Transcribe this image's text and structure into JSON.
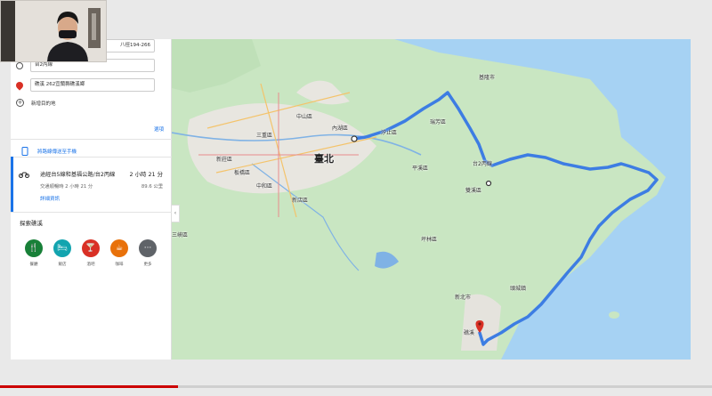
{
  "sidebar": {
    "stops": [
      {
        "label": "八徑194-266"
      },
      {
        "label": "台2丙線"
      },
      {
        "label": "礁溪 262宜蘭縣礁溪鄉"
      }
    ],
    "add_destination": "新增目的地",
    "options_link": "選項",
    "send_to_phone": "將路線傳送至手機",
    "route": {
      "title": "途經台5線和基福公路/台2丙線",
      "time": "2 小時 21 分",
      "traffic": "交通順暢時 2 小時 21 分",
      "distance": "89.6 公里",
      "details_link": "詳細資訊"
    },
    "explore_title": "探索礁溪",
    "categories": [
      {
        "label": "餐廳",
        "icon": "restaurant-icon",
        "color": "#188038",
        "glyph": "🍴"
      },
      {
        "label": "飯店",
        "icon": "hotel-icon",
        "color": "#12a4af",
        "glyph": "🛏"
      },
      {
        "label": "酒吧",
        "icon": "bar-icon",
        "color": "#d93025",
        "glyph": "🍸"
      },
      {
        "label": "咖啡",
        "icon": "coffee-icon",
        "color": "#e8710a",
        "glyph": "☕"
      },
      {
        "label": "更多",
        "icon": "more-icon",
        "color": "#5f6368",
        "glyph": "···"
      }
    ]
  },
  "map": {
    "city_label": "臺北",
    "labels": [
      {
        "text": "中山區"
      },
      {
        "text": "內湖區"
      },
      {
        "text": "汐止區"
      },
      {
        "text": "新店區"
      },
      {
        "text": "中和區"
      },
      {
        "text": "板橋區"
      },
      {
        "text": "新莊區"
      },
      {
        "text": "三峽區"
      },
      {
        "text": "瑞芳區"
      },
      {
        "text": "台2丙線"
      },
      {
        "text": "礁溪"
      },
      {
        "text": "新北市"
      },
      {
        "text": "平溪區"
      },
      {
        "text": "雙溪區"
      },
      {
        "text": "坪林區"
      },
      {
        "text": "頭城鎮"
      },
      {
        "text": "三重區"
      },
      {
        "text": "基隆市"
      }
    ],
    "route_color": "#3d7de3",
    "colors": {
      "land": "#c9e6c2",
      "sea": "#a6d2f3",
      "urban": "#e8e6e0"
    }
  }
}
